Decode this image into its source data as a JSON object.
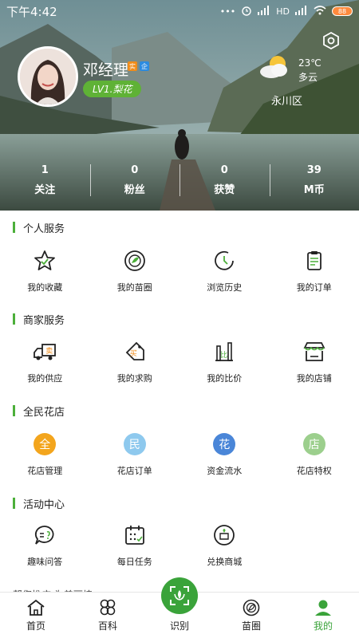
{
  "status_bar": {
    "time": "下午4:42",
    "dots": "•••",
    "network": "HD",
    "battery": "88"
  },
  "profile": {
    "name": "邓经理",
    "badge_1": "实",
    "badge_2": "企",
    "level": "LV1.梨花"
  },
  "weather": {
    "temp": "23℃",
    "condition": "多云",
    "district": "永川区"
  },
  "stats": [
    {
      "num": "1",
      "label": "关注"
    },
    {
      "num": "0",
      "label": "粉丝"
    },
    {
      "num": "0",
      "label": "获赞"
    },
    {
      "num": "39",
      "label": "M币"
    }
  ],
  "sections": {
    "personal": {
      "title": "个人服务",
      "items": [
        "我的收藏",
        "我的苗圈",
        "浏览历史",
        "我的订单"
      ]
    },
    "merchant": {
      "title": "商家服务",
      "items": [
        "我的供应",
        "我的求购",
        "我的比价",
        "我的店铺"
      ],
      "supply_glyph": "卖",
      "buy_glyph": "买",
      "compare_glyph": "比"
    },
    "flower": {
      "title": "全民花店",
      "items": [
        "花店管理",
        "花店订单",
        "资金流水",
        "花店特权"
      ],
      "glyphs": [
        "全",
        "民",
        "花",
        "店"
      ]
    },
    "activity": {
      "title": "活动中心",
      "items": [
        "趣味问答",
        "每日任务",
        "兑换商城"
      ]
    },
    "peek": "帮您推广 为美丽植"
  },
  "tabbar": {
    "items": [
      "首页",
      "百科",
      "识别",
      "苗圈",
      "我的"
    ],
    "active_color": "#3aa33a"
  },
  "colors": {
    "accent": "#4caf3a",
    "level_bg": "#5fb236"
  }
}
